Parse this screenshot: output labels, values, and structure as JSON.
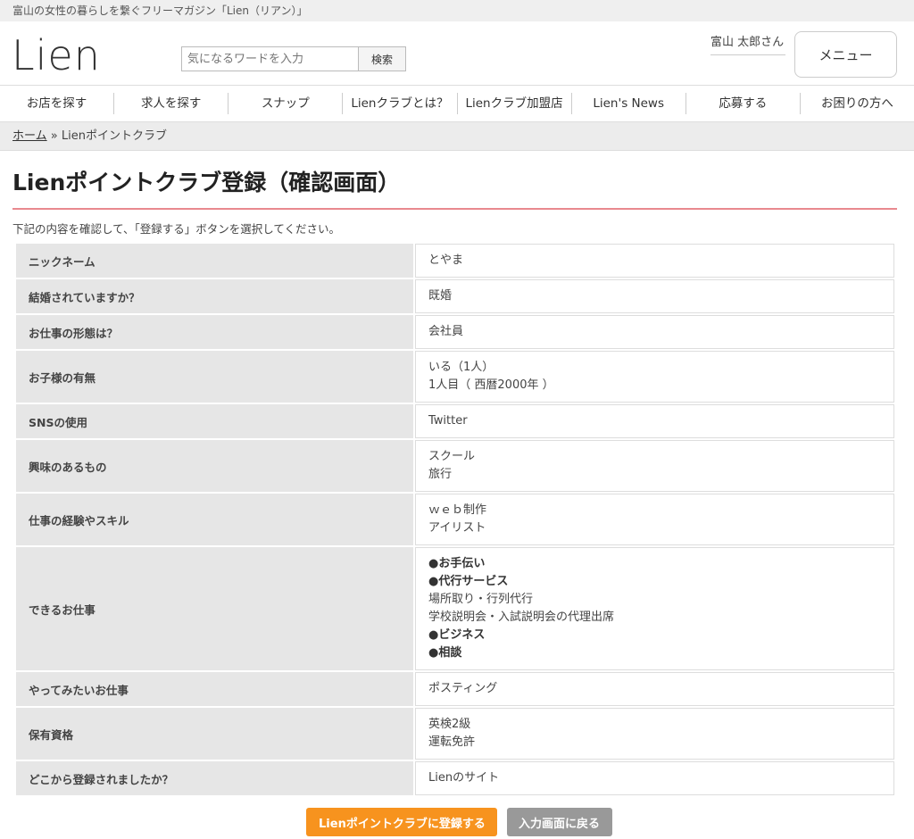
{
  "topbar": {
    "tagline": "富山の女性の暮らしを繋ぐフリーマガジン「Lien（リアン）」"
  },
  "header": {
    "logo": "Lien",
    "search_placeholder": "気になるワードを入力",
    "search_button": "検索",
    "user": "富山 太郎さん",
    "menu_button": "メニュー"
  },
  "nav": [
    "お店を探す",
    "求人を探す",
    "スナップ",
    "Lienクラブとは？",
    "Lienクラブ加盟店",
    "Lien's News",
    "応募する",
    "お困りの方へ"
  ],
  "breadcrumb": {
    "home": "ホーム",
    "separator": "»",
    "current": "Lienポイントクラブ"
  },
  "page": {
    "title": "Lienポイントクラブ登録（確認画面）",
    "intro": "下記の内容を確認して、「登録する」ボタンを選択してください。"
  },
  "rows": [
    {
      "label": "ニックネーム",
      "lines": [
        "とやま"
      ]
    },
    {
      "label": "結婚されていますか？",
      "lines": [
        "既婚"
      ]
    },
    {
      "label": "お仕事の形態は？",
      "lines": [
        "会社員"
      ]
    },
    {
      "label": "お子様の有無",
      "lines": [
        "いる（1人）",
        "1人目（ 西暦2000年 ）"
      ]
    },
    {
      "label": "SNSの使用",
      "lines": [
        "Twitter"
      ]
    },
    {
      "label": "興味のあるもの",
      "lines": [
        "スクール",
        "旅行"
      ]
    },
    {
      "label": "仕事の経験やスキル",
      "lines": [
        "ｗｅｂ制作",
        "アイリスト"
      ]
    },
    {
      "label": "できるお仕事",
      "lines": [
        "●お手伝い",
        "●代行サービス",
        "場所取り・行列代行",
        "学校説明会・入試説明会の代理出席",
        "●ビジネス",
        "●相談"
      ]
    },
    {
      "label": "やってみたいお仕事",
      "lines": [
        "ポスティング"
      ]
    },
    {
      "label": "保有資格",
      "lines": [
        "英検2級",
        "運転免許"
      ]
    },
    {
      "label": "どこから登録されましたか？",
      "lines": [
        "Lienのサイト"
      ]
    }
  ],
  "actions": {
    "submit": "Lienポイントクラブに登録する",
    "back": "入力画面に戻る"
  }
}
